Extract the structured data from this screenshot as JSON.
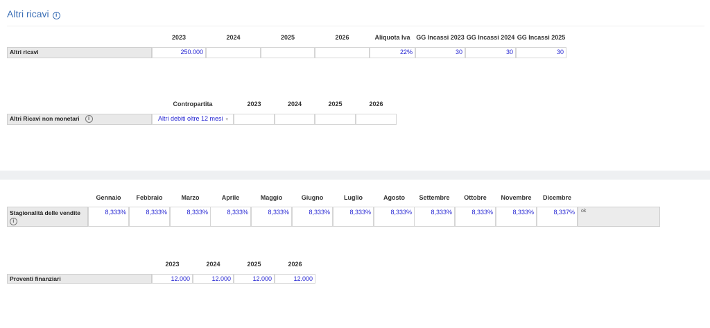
{
  "title": "Altri ricavi",
  "section1": {
    "headers": [
      "2023",
      "2024",
      "2025",
      "2026",
      "Aliquota Iva",
      "GG Incassi 2023",
      "GG Incassi 2024",
      "GG Incassi 2025"
    ],
    "row_label": "Altri ricavi",
    "values": [
      "250.000",
      "",
      "",
      "",
      "22%",
      "30",
      "30",
      "30"
    ]
  },
  "section2": {
    "headers": [
      "Contropartita",
      "2023",
      "2024",
      "2025",
      "2026"
    ],
    "row_label": "Altri Ricavi non monetari",
    "contropartita": "Altri debiti oltre 12 mesi",
    "values": [
      "",
      "",
      "",
      ""
    ]
  },
  "section3": {
    "headers": [
      "Gennaio",
      "Febbraio",
      "Marzo",
      "Aprile",
      "Maggio",
      "Giugno",
      "Luglio",
      "Agosto",
      "Settembre",
      "Ottobre",
      "Novembre",
      "Dicembre"
    ],
    "row_label": "Stagionalità delle vendite",
    "values": [
      "8,333%",
      "8,333%",
      "8,333%",
      "8,333%",
      "8,333%",
      "8,333%",
      "8,333%",
      "8,333%",
      "8,333%",
      "8,333%",
      "8,333%",
      "8,337%"
    ],
    "status": "ok"
  },
  "section4": {
    "headers": [
      "2023",
      "2024",
      "2025",
      "2026"
    ],
    "row_label": "Proventi finanziari",
    "values": [
      "12.000",
      "12.000",
      "12.000",
      "12.000"
    ]
  },
  "icons": {
    "info": "info-circle-icon",
    "dropdown": "chevron-down-icon"
  },
  "colors": {
    "title": "#3b6fb6",
    "values": "#1f1fd1"
  }
}
